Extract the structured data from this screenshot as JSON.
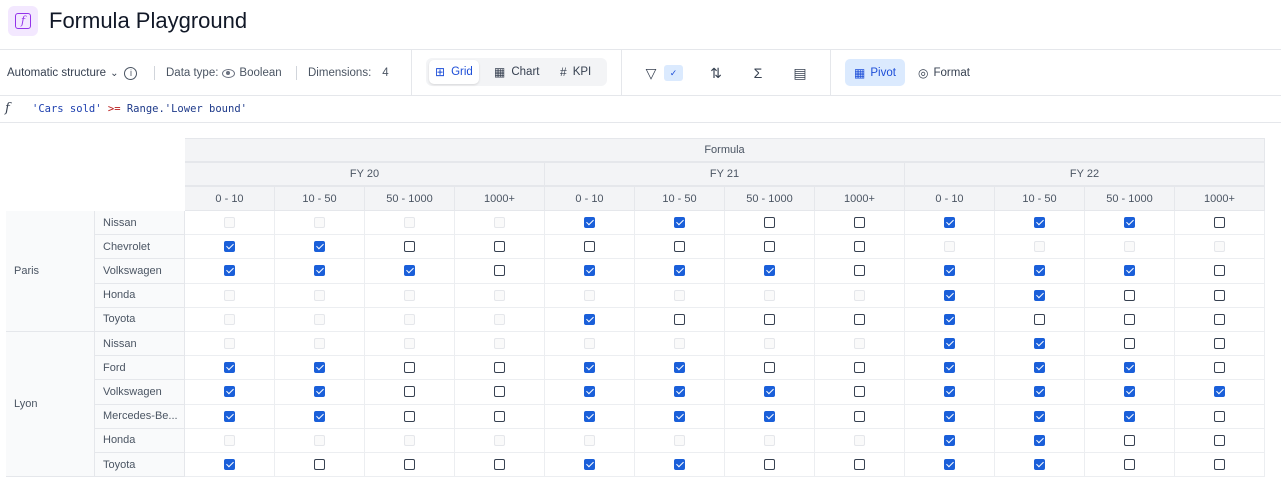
{
  "header": {
    "title": "Formula Playground",
    "app_icon": "formula-icon"
  },
  "toolbar": {
    "structure_label": "Automatic structure",
    "data_type_label": "Data type:",
    "data_type_value": "Boolean",
    "dimensions_label": "Dimensions:",
    "dimensions_value": "4",
    "views": [
      {
        "label": "Grid",
        "icon": "grid-icon",
        "active": true
      },
      {
        "label": "Chart",
        "icon": "chart-icon",
        "active": false
      },
      {
        "label": "KPI",
        "icon": "hash-icon",
        "active": false
      }
    ],
    "pivot_label": "Pivot",
    "format_label": "Format"
  },
  "formula": {
    "str1": "'Cars sold'",
    "op": ">=",
    "str2": "Range.'Lower bound'"
  },
  "grid": {
    "top_header": "Formula",
    "years": [
      "FY 20",
      "FY 21",
      "FY 22"
    ],
    "ranges": [
      "0 - 10",
      "10 - 50",
      "50 - 1000",
      "1000+"
    ],
    "cities": [
      {
        "name": "Paris",
        "rows": [
          {
            "brand": "Nissan",
            "values": [
              "e",
              "e",
              "e",
              "e",
              "1",
              "1",
              "0",
              "0",
              "1",
              "1",
              "1",
              "0"
            ]
          },
          {
            "brand": "Chevrolet",
            "values": [
              "1",
              "1",
              "0",
              "0",
              "0",
              "0",
              "0",
              "0",
              "e",
              "e",
              "e",
              "e"
            ]
          },
          {
            "brand": "Volkswagen",
            "values": [
              "1",
              "1",
              "1",
              "0",
              "1",
              "1",
              "1",
              "0",
              "1",
              "1",
              "1",
              "0"
            ]
          },
          {
            "brand": "Honda",
            "values": [
              "e",
              "e",
              "e",
              "e",
              "e",
              "e",
              "e",
              "e",
              "1",
              "1",
              "0",
              "0"
            ]
          },
          {
            "brand": "Toyota",
            "values": [
              "e",
              "e",
              "e",
              "e",
              "1",
              "0",
              "0",
              "0",
              "1",
              "0",
              "0",
              "0"
            ]
          }
        ]
      },
      {
        "name": "Lyon",
        "rows": [
          {
            "brand": "Nissan",
            "values": [
              "e",
              "e",
              "e",
              "e",
              "e",
              "e",
              "e",
              "e",
              "1",
              "1",
              "0",
              "0"
            ]
          },
          {
            "brand": "Ford",
            "values": [
              "1",
              "1",
              "0",
              "0",
              "1",
              "1",
              "0",
              "0",
              "1",
              "1",
              "1",
              "0"
            ]
          },
          {
            "brand": "Volkswagen",
            "values": [
              "1",
              "1",
              "0",
              "0",
              "1",
              "1",
              "1",
              "0",
              "1",
              "1",
              "1",
              "1"
            ]
          },
          {
            "brand": "Mercedes-Be...",
            "values": [
              "1",
              "1",
              "0",
              "0",
              "1",
              "1",
              "1",
              "0",
              "1",
              "1",
              "1",
              "0"
            ]
          },
          {
            "brand": "Honda",
            "values": [
              "e",
              "e",
              "e",
              "e",
              "e",
              "e",
              "e",
              "e",
              "1",
              "1",
              "0",
              "0"
            ]
          },
          {
            "brand": "Toyota",
            "values": [
              "1",
              "0",
              "0",
              "0",
              "1",
              "1",
              "0",
              "0",
              "1",
              "1",
              "0",
              "0"
            ]
          }
        ]
      }
    ]
  }
}
